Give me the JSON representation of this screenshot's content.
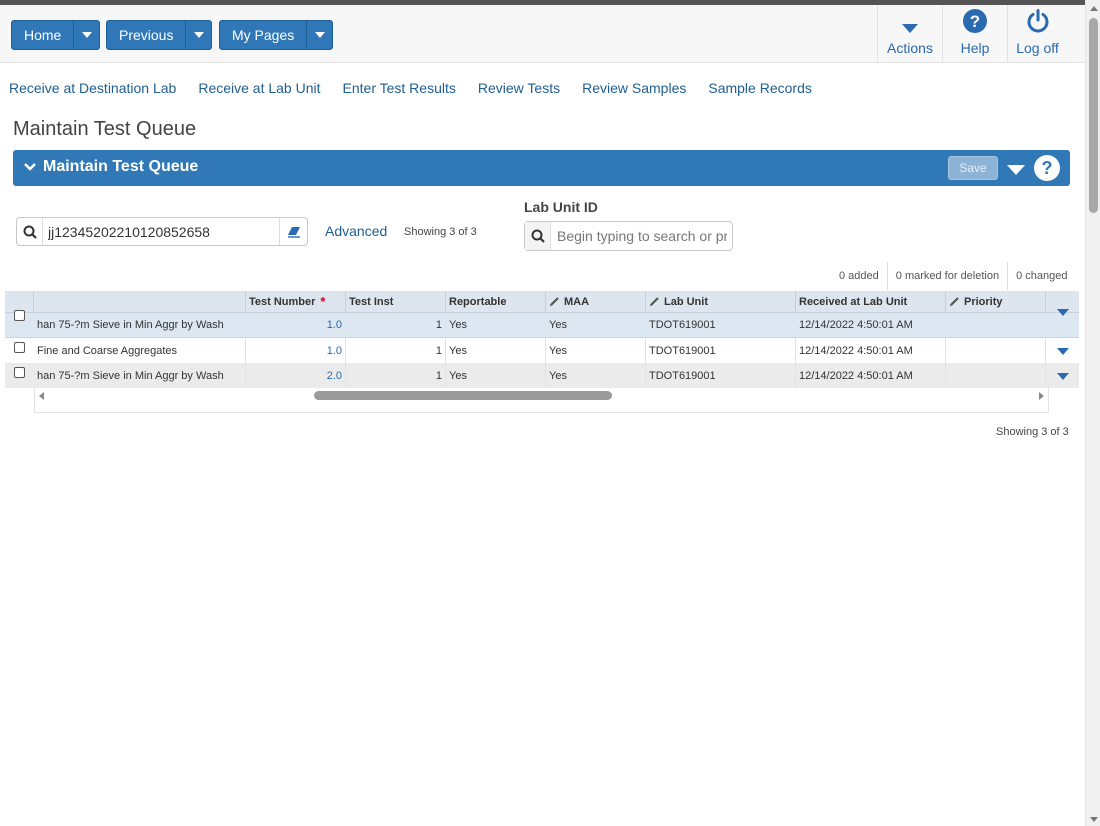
{
  "nav": {
    "home_label": "Home",
    "previous_label": "Previous",
    "mypages_label": "My Pages",
    "actions_label": "Actions",
    "help_label": "Help",
    "logoff_label": "Log off"
  },
  "links": [
    "Receive at Destination Lab",
    "Receive at Lab Unit",
    "Enter Test Results",
    "Review Tests",
    "Review Samples",
    "Sample Records"
  ],
  "page_title": "Maintain Test Queue",
  "panel": {
    "title": "Maintain Test Queue",
    "save_label": "Save",
    "help_glyph": "?"
  },
  "search": {
    "value": "jj12345202210120852658",
    "advanced_label": "Advanced",
    "showing": "Showing 3 of 3"
  },
  "lab_unit": {
    "label": "Lab Unit ID",
    "placeholder": "Begin typing to search or pr"
  },
  "counts": {
    "added": "0 added",
    "deleted": "0 marked for deletion",
    "changed": "0 changed"
  },
  "grid": {
    "columns": [
      "",
      "Test Number",
      "Test Inst",
      "Reportable",
      "MAA",
      "Lab Unit",
      "Received at Lab Unit",
      "Priority"
    ],
    "required_marker": "*",
    "rows": [
      {
        "test": "han 75-?m Sieve in Min Aggr by Wash",
        "number": "1.0",
        "inst": "1",
        "reportable": "Yes",
        "maa": "Yes",
        "lab_unit": "TDOT619001",
        "received": "12/14/2022 4:50:01 AM",
        "priority": ""
      },
      {
        "test": "Fine and Coarse Aggregates",
        "number": "1.0",
        "inst": "1",
        "reportable": "Yes",
        "maa": "Yes",
        "lab_unit": "TDOT619001",
        "received": "12/14/2022 4:50:01 AM",
        "priority": ""
      },
      {
        "test": "han 75-?m Sieve in Min Aggr by Wash",
        "number": "2.0",
        "inst": "1",
        "reportable": "Yes",
        "maa": "Yes",
        "lab_unit": "TDOT619001",
        "received": "12/14/2022 4:50:01 AM",
        "priority": ""
      }
    ],
    "showing_bottom": "Showing 3 of 3"
  },
  "colors": {
    "accent": "#3079b6",
    "link": "#1f5e91",
    "row_selected": "#dde7f1",
    "row_alt": "#ebebeb"
  }
}
